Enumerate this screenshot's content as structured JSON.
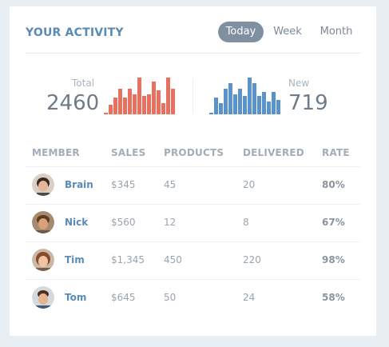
{
  "header": {
    "title": "YOUR ACTIVITY",
    "tabs": [
      {
        "label": "Today",
        "active": true
      },
      {
        "label": "Week",
        "active": false
      },
      {
        "label": "Month",
        "active": false
      }
    ]
  },
  "stats": {
    "total": {
      "label": "Total",
      "value": "2460",
      "color": "#e8705f",
      "bars": [
        0.05,
        0.25,
        0.45,
        0.7,
        0.45,
        0.7,
        0.55,
        1.0,
        0.5,
        0.55,
        0.9,
        0.65,
        0.3,
        1.0,
        0.7
      ]
    },
    "new": {
      "label": "New",
      "value": "719",
      "color": "#5a93c9",
      "bars": [
        0.05,
        0.45,
        0.3,
        0.7,
        0.85,
        0.55,
        0.7,
        0.5,
        1.0,
        0.85,
        0.5,
        0.6,
        0.35,
        0.6,
        0.4
      ]
    }
  },
  "table": {
    "columns": [
      "MEMBER",
      "SALES",
      "PRODUCTS",
      "DELIVERED",
      "RATE"
    ],
    "rows": [
      {
        "member": "Brain",
        "sales": "$345",
        "products": "45",
        "delivered": "20",
        "rate": "80%",
        "avatar": "avatar-brain"
      },
      {
        "member": "Nick",
        "sales": "$560",
        "products": "12",
        "delivered": "8",
        "rate": "67%",
        "avatar": "avatar-nick"
      },
      {
        "member": "Tim",
        "sales": "$1,345",
        "products": "450",
        "delivered": "220",
        "rate": "98%",
        "avatar": "avatar-tim"
      },
      {
        "member": "Tom",
        "sales": "$645",
        "products": "50",
        "delivered": "24",
        "rate": "58%",
        "avatar": "avatar-tom"
      }
    ]
  }
}
